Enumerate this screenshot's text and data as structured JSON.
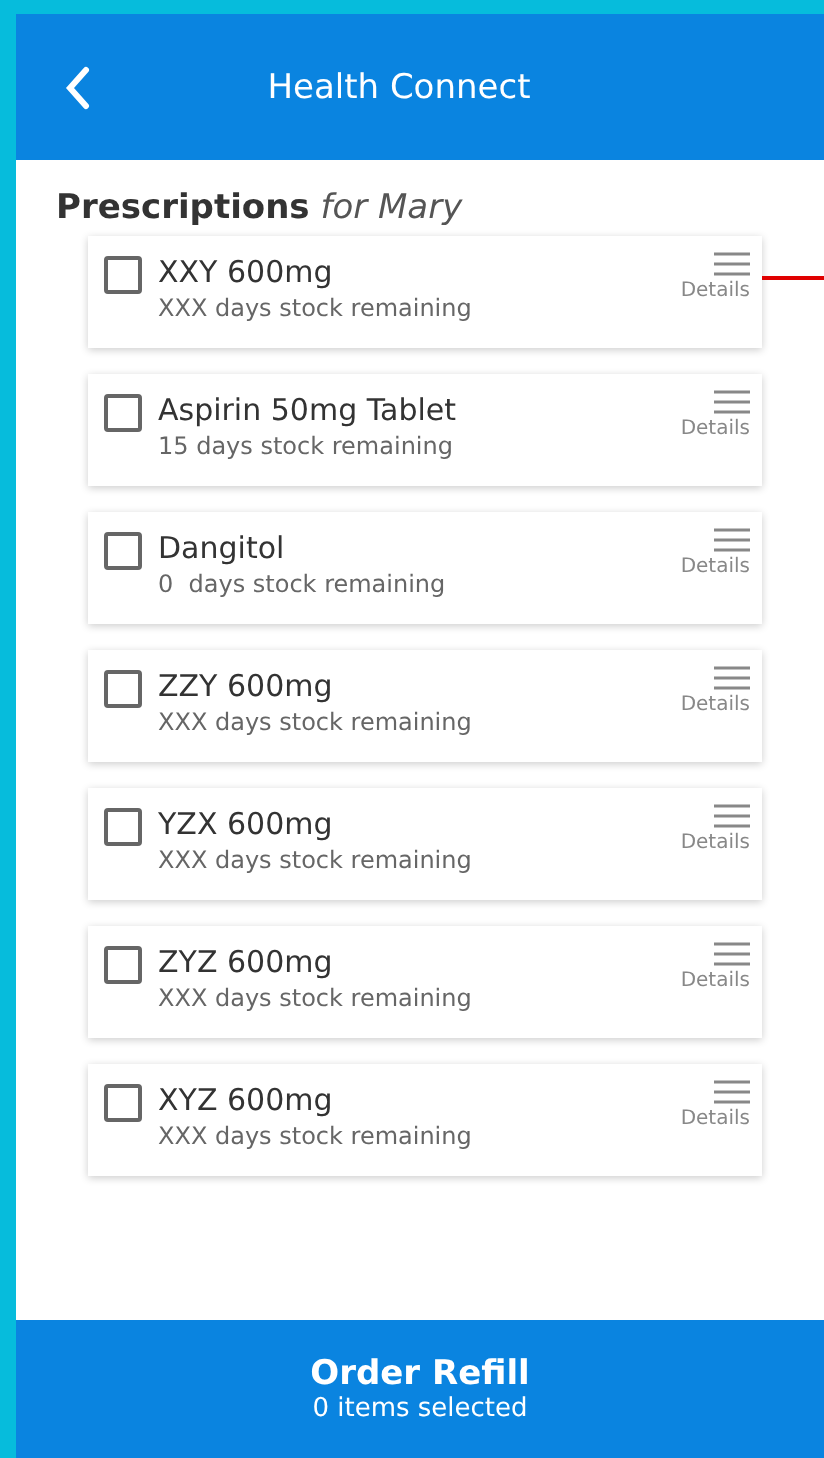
{
  "header": {
    "title": "Health Connect"
  },
  "section": {
    "title": "Prescriptions",
    "subtitle": "for Mary"
  },
  "prescriptions": [
    {
      "name": "XXY 600mg",
      "stock": "XXX days stock remaining",
      "details": "Details",
      "checked": false
    },
    {
      "name": "Aspirin 50mg Tablet",
      "stock": "15 days stock remaining",
      "details": "Details",
      "checked": false
    },
    {
      "name": "Dangitol",
      "stock": "0  days stock remaining",
      "details": "Details",
      "checked": false
    },
    {
      "name": "ZZY 600mg",
      "stock": "XXX days stock remaining",
      "details": "Details",
      "checked": false
    },
    {
      "name": "YZX 600mg",
      "stock": "XXX days stock remaining",
      "details": "Details",
      "checked": false
    },
    {
      "name": "ZYZ 600mg",
      "stock": "XXX days stock remaining",
      "details": "Details",
      "checked": false
    },
    {
      "name": "XYZ 600mg",
      "stock": "XXX days stock remaining",
      "details": "Details",
      "checked": false
    }
  ],
  "footer": {
    "button": "Order Refill",
    "count": "0 items selected"
  }
}
